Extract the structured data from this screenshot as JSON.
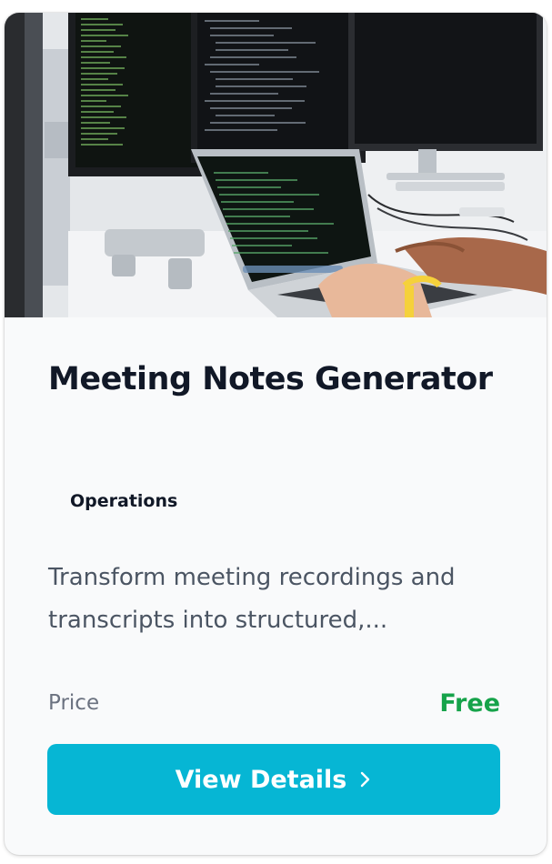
{
  "card": {
    "title": "Meeting Notes Generator",
    "category": "Operations",
    "description": "Transform meeting recordings and transcripts into structured,...",
    "price_label": "Price",
    "price_value": "Free",
    "button_label": "View Details",
    "button_icon": "chevron-right-icon",
    "colors": {
      "accent": "#06b6d4",
      "price": "#16a34a",
      "title": "#111827",
      "description": "#4b5563"
    }
  }
}
